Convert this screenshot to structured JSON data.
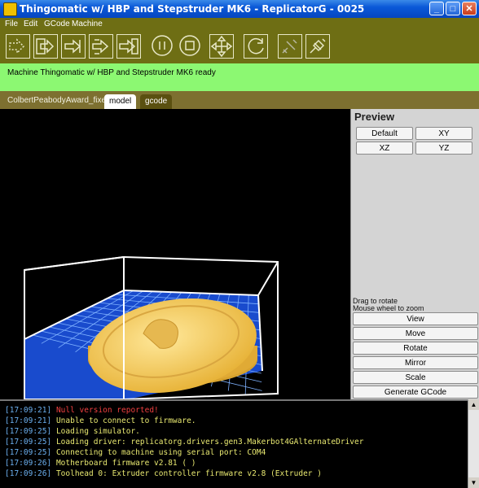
{
  "window": {
    "title": "Thingomatic w/ HBP and Stepstruder MK6 - ReplicatorG - 0025",
    "min_glyph": "_",
    "max_glyph": "□",
    "close_glyph": "✕"
  },
  "menu": [
    "File",
    "Edit",
    "GCode",
    "Machine"
  ],
  "toolbar": {
    "buttons": [
      {
        "icon": "build-icon"
      },
      {
        "icon": "build-to-file-icon"
      },
      {
        "icon": "upload-icon"
      },
      {
        "icon": "simulate-icon"
      },
      {
        "icon": "build-from-file-icon"
      },
      {
        "icon": "pause-icon"
      },
      {
        "icon": "stop-icon"
      },
      {
        "icon": "control-panel-icon"
      },
      {
        "icon": "reset-icon"
      },
      {
        "icon": "disconnect-icon"
      },
      {
        "icon": "connect-icon"
      }
    ],
    "colors": {
      "bar": "#6e6e14",
      "icon_stroke": "#e8e8c8"
    }
  },
  "status": {
    "text": "Machine Thingomatic w/ HBP and Stepstruder MK6 ready"
  },
  "tabs": {
    "file_name": "ColbertPeabodyAward_fixed",
    "model": "model",
    "gcode": "gcode"
  },
  "preview": {
    "title": "Preview",
    "views": [
      "Default",
      "XY",
      "XZ",
      "YZ"
    ],
    "hint_rotate": "Drag to rotate",
    "hint_zoom": "Mouse wheel to zoom",
    "actions": [
      "View",
      "Move",
      "Rotate",
      "Mirror",
      "Scale",
      "Generate GCode"
    ]
  },
  "console": {
    "lines": [
      {
        "time": "[17:09:21]",
        "text": "Null version reported!",
        "error": true
      },
      {
        "time": "[17:09:21]",
        "text": "Unable to connect to firmware.",
        "error": false
      },
      {
        "time": "[17:09:25]",
        "text": "Loading simulator.",
        "error": false
      },
      {
        "time": "[17:09:25]",
        "text": "Loading driver: replicatorg.drivers.gen3.Makerbot4GAlternateDriver",
        "error": false
      },
      {
        "time": "[17:09:25]",
        "text": "Connecting to machine using serial port: COM4",
        "error": false
      },
      {
        "time": "[17:09:26]",
        "text": "Motherboard firmware v2.81 ( )",
        "error": false
      },
      {
        "time": "[17:09:26]",
        "text": "Toolhead 0: Extruder controller firmware v2.8 (Extruder )",
        "error": false
      }
    ]
  },
  "colors": {
    "status_bg": "#8cf872",
    "grid_blue": "#1a4fd8",
    "model_gold": "#f5c542"
  }
}
